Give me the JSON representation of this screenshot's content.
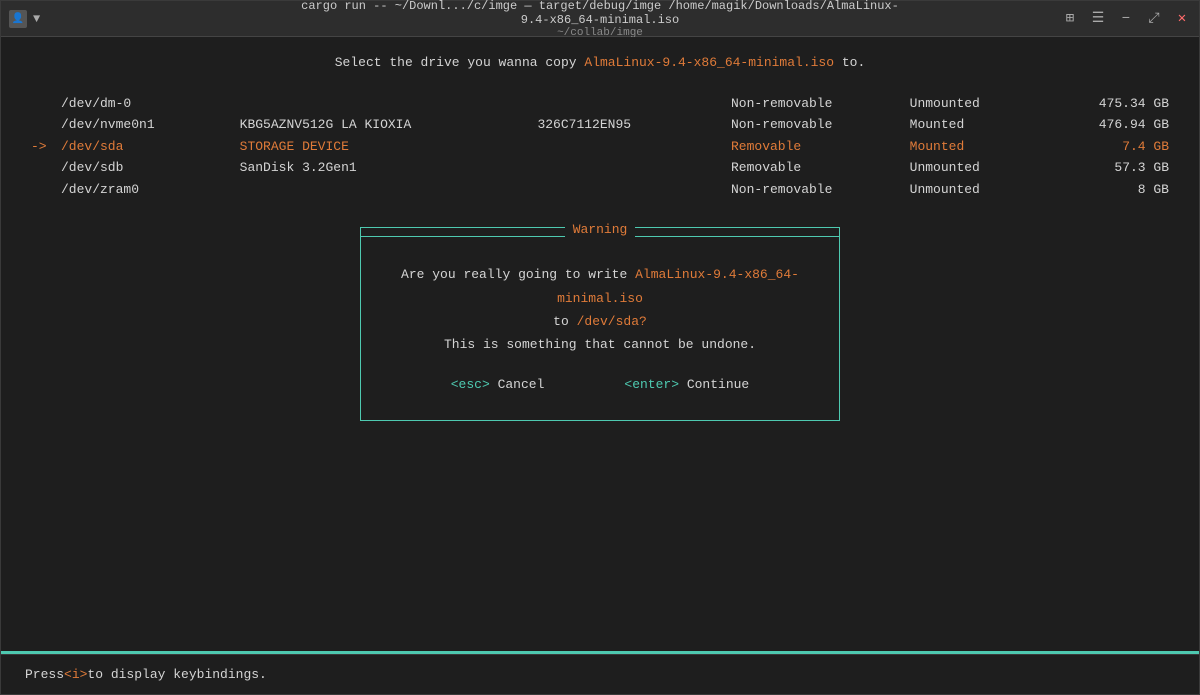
{
  "window": {
    "title": "cargo run -- ~/Downl.../c/imge — target/debug/imge /home/magik/Downloads/AlmaLinux-9.4-x86_64-minimal.iso",
    "subtitle": "~/collab/imge"
  },
  "titlebar": {
    "avatar_icon": "👤",
    "dropdown_icon": "▼",
    "tile_icon": "⊞",
    "menu_icon": "☰",
    "minimize_label": "−",
    "restore_label": "⤢",
    "close_label": "✕"
  },
  "terminal": {
    "prompt": "Select the drive you wanna copy",
    "iso_name": "AlmaLinux-9.4-x86_64-minimal.iso",
    "prompt_suffix": " to.",
    "drives": [
      {
        "arrow": "",
        "device": "/dev/dm-0",
        "model": "",
        "serial": "",
        "removable": "Non-removable",
        "mounted": "Unmounted",
        "size": "475.34 GB"
      },
      {
        "arrow": "",
        "device": "/dev/nvme0n1",
        "model": "KBG5AZNV512G LA KIOXIA",
        "serial": "326C7112EN95",
        "removable": "Non-removable",
        "mounted": "Mounted",
        "size": "476.94 GB"
      },
      {
        "arrow": "->",
        "device": "/dev/sda",
        "model": "STORAGE DEVICE",
        "serial": "",
        "removable": "Removable",
        "mounted": "Mounted",
        "size": "7.4 GB",
        "selected": true
      },
      {
        "arrow": "",
        "device": "/dev/sdb",
        "model": "SanDisk 3.2Gen1",
        "serial": "",
        "removable": "Removable",
        "mounted": "Unmounted",
        "size": "57.3 GB"
      },
      {
        "arrow": "",
        "device": "/dev/zram0",
        "model": "",
        "serial": "",
        "removable": "Non-removable",
        "mounted": "Unmounted",
        "size": "8 GB"
      }
    ]
  },
  "warning": {
    "title": "Warning",
    "line1_prefix": "Are you really going to write",
    "iso_name": "AlmaLinux-9.4-x86_64-minimal.iso",
    "line2_prefix": "to",
    "device": "/dev/sda?",
    "line3": "This is something that cannot be undone.",
    "cancel_key": "<esc>",
    "cancel_label": "Cancel",
    "continue_key": "<enter>",
    "continue_label": "Continue"
  },
  "statusbar": {
    "prefix": "Press ",
    "key": "<i>",
    "suffix": " to display keybindings."
  }
}
